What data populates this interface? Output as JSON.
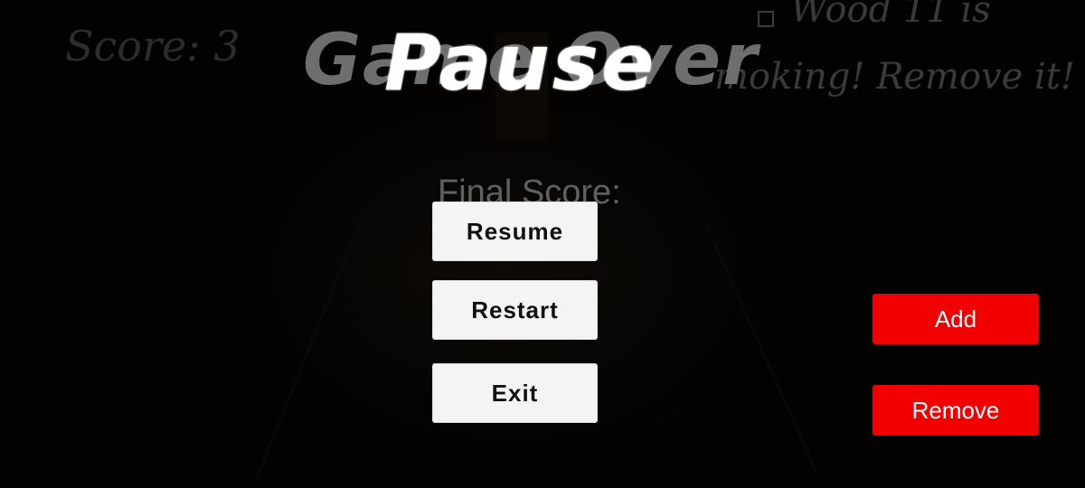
{
  "hud": {
    "score_text": "Score: 3"
  },
  "task": {
    "line1": "Wood 11 is",
    "line2": "moking! Remove it!",
    "checked": false
  },
  "game_over": {
    "title": "Game Over",
    "final_score_label": "Final Score:"
  },
  "pause_menu": {
    "title": "Pause",
    "resume_label": "Resume",
    "restart_label": "Restart",
    "exit_label": "Exit"
  },
  "controls": {
    "add_label": "Add",
    "remove_label": "Remove",
    "accent_color": "#f20000"
  }
}
